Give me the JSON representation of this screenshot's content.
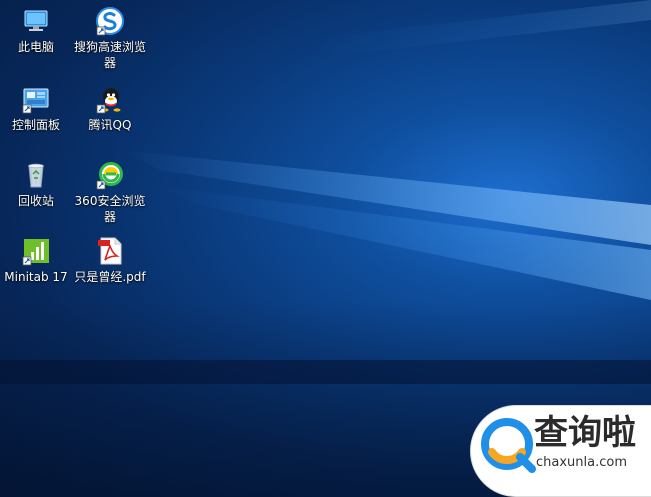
{
  "desktop": {
    "icons": [
      {
        "label": "此电脑",
        "icon": "this-pc-icon"
      },
      {
        "label": "搜狗高速浏览器",
        "icon": "sogou-browser-icon"
      },
      {
        "label": "控制面板",
        "icon": "control-panel-icon"
      },
      {
        "label": "腾讯QQ",
        "icon": "qq-icon"
      },
      {
        "label": "回收站",
        "icon": "recycle-bin-icon"
      },
      {
        "label": "360安全浏览器",
        "icon": "360-browser-icon"
      },
      {
        "label": "Minitab 17",
        "icon": "minitab-icon"
      },
      {
        "label": "只是曾经.pdf",
        "icon": "pdf-file-icon"
      }
    ]
  },
  "watermark": {
    "title": "查询啦",
    "url": "chaxunla.com"
  },
  "colors": {
    "wallpaper_dark": "#051a40",
    "wallpaper_mid": "#0a3a7c",
    "wallpaper_light": "#1d6fd0",
    "watermark_blue": "#1f8fe8",
    "watermark_orange": "#f5a623"
  }
}
